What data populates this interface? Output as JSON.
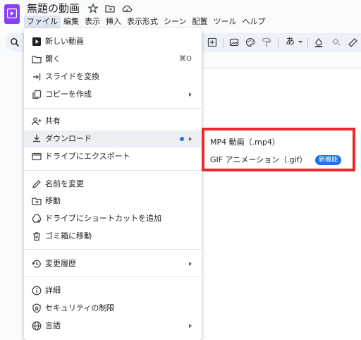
{
  "document": {
    "title": "無題の動画"
  },
  "menubar": {
    "items": [
      "ファイル",
      "編集",
      "表示",
      "挿入",
      "表示形式",
      "シーン",
      "配置",
      "ツール",
      "ヘルプ"
    ]
  },
  "toolbar": {
    "text_style_label": "あ"
  },
  "file_menu": {
    "items": [
      {
        "label": "新しい動画",
        "icon": "video-icon"
      },
      {
        "label": "開く",
        "icon": "folder-icon",
        "shortcut": "⌘O"
      },
      {
        "label": "スライドを変換",
        "icon": "import-icon"
      },
      {
        "label": "コピーを作成",
        "icon": "copy-icon",
        "submenu": true
      },
      {
        "label": "共有",
        "icon": "share-person-icon"
      },
      {
        "label": "ダウンロード",
        "icon": "download-icon",
        "submenu": true,
        "new_dot": true,
        "highlighted": true
      },
      {
        "label": "ドライブにエクスポート",
        "icon": "film-icon"
      },
      {
        "label": "名前を変更",
        "icon": "pencil-icon"
      },
      {
        "label": "移動",
        "icon": "folder-move-icon"
      },
      {
        "label": "ドライブにショートカットを追加",
        "icon": "drive-shortcut-icon"
      },
      {
        "label": "ゴミ箱に移動",
        "icon": "trash-icon"
      },
      {
        "label": "変更履歴",
        "icon": "history-icon",
        "submenu": true
      },
      {
        "label": "詳細",
        "icon": "info-icon"
      },
      {
        "label": "セキュリティの制限",
        "icon": "shield-icon"
      },
      {
        "label": "言語",
        "icon": "globe-icon",
        "submenu": true
      }
    ]
  },
  "download_submenu": {
    "items": [
      {
        "label": "MP4 動画（.mp4）"
      },
      {
        "label": "GIF アニメーション（.gif）",
        "badge": "新機能"
      }
    ]
  },
  "colors": {
    "accent": "#1a73e8",
    "brand": "#8a3ffc",
    "highlight_border": "#ea2a2a"
  }
}
